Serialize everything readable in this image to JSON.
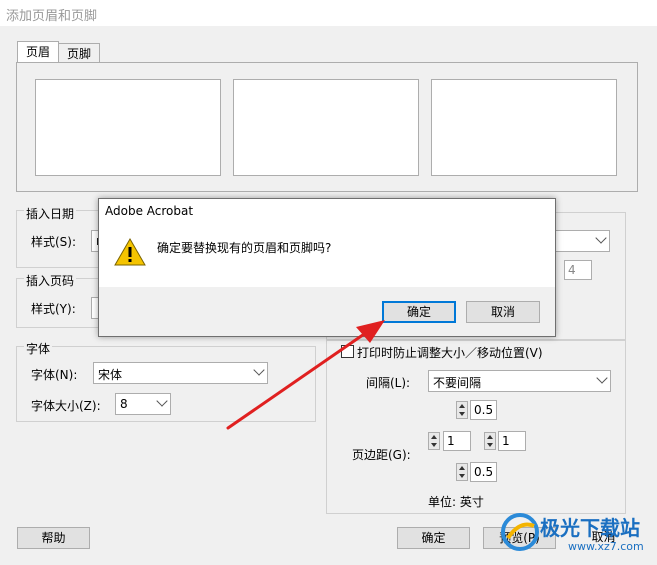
{
  "window": {
    "title": "添加页眉和页脚"
  },
  "tabs": [
    {
      "label": "页眉"
    },
    {
      "label": "页脚"
    }
  ],
  "date_group": {
    "title": "插入日期",
    "style_label": "样式(S):",
    "style_value": "m"
  },
  "page_group": {
    "title": "插入页码",
    "style_label": "样式(Y):"
  },
  "start_page": {
    "value": "4"
  },
  "font_group": {
    "title": "字体",
    "font_label": "字体(N):",
    "font_value": "宋体",
    "size_label": "字体大小(Z):",
    "size_value": "8"
  },
  "layout_group": {
    "print_checkbox_label": "打印时防止调整大小／移动位置(V)",
    "spacing_label": "间隔(L):",
    "spacing_value": "不要间隔",
    "margin_label": "页边距(G):",
    "top_value": "0.5",
    "left_value": "1",
    "right_value": "1",
    "bottom_value": "0.5",
    "unit_text": "单位: 英寸"
  },
  "footer_buttons": {
    "help": "帮助",
    "ok": "确定",
    "preview": "预览(P)",
    "cancel": "取消"
  },
  "dialog": {
    "title": "Adobe Acrobat",
    "message": "确定要替换现有的页眉和页脚吗?",
    "ok": "确定",
    "cancel": "取消"
  },
  "watermark": {
    "name": "极光下载站",
    "url": "www.xz7.com"
  },
  "colors": {
    "accent": "#0078d7",
    "arrow": "#e02020",
    "warning": "#f5c400"
  }
}
